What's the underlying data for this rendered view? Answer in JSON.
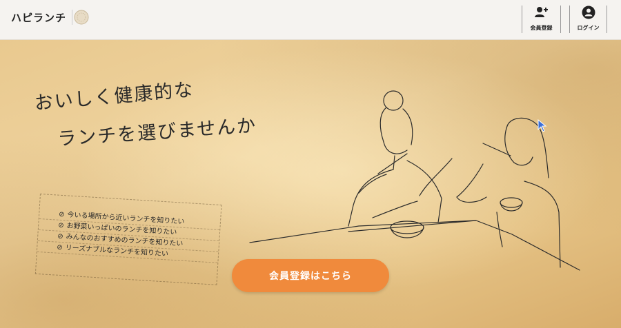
{
  "header": {
    "brand_title": "ハピランチ",
    "register_label": "会員登録",
    "login_label": "ログイン"
  },
  "hero": {
    "headline_line1": "おいしく健康的な",
    "headline_line2": "ランチを選びませんか",
    "checklist": [
      "今いる場所から近いランチを知りたい",
      "お野菜いっぱいのランチを知りたい",
      "みんなのおすすめのランチを知りたい",
      "リーズナブルなランチを知りたい"
    ],
    "cta_label": "会員登録はこちら"
  },
  "colors": {
    "accent": "#f08a3c",
    "header_bg": "#f5f3f0",
    "paper": "#e9c98f"
  },
  "icons": {
    "add_user": "add-user-icon",
    "account": "account-circle-icon",
    "check": "check-circle-icon"
  }
}
